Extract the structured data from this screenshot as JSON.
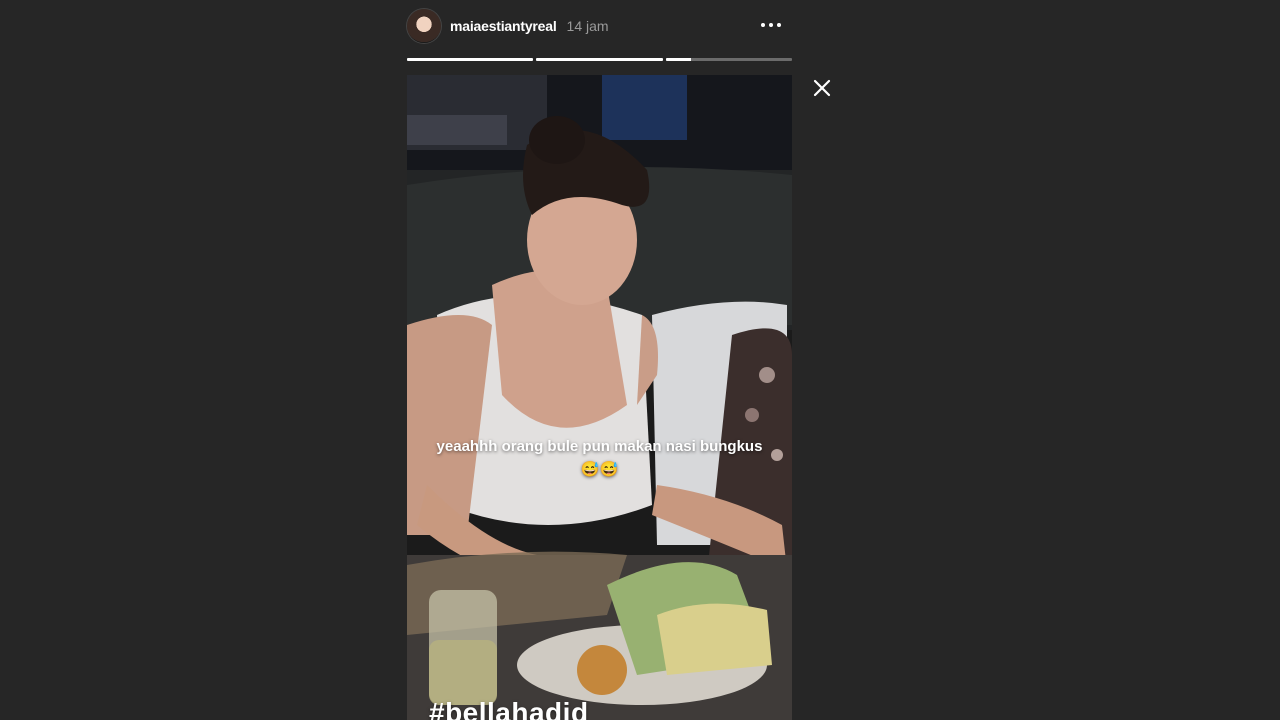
{
  "story": {
    "username": "maiaestiantyreal",
    "timestamp": "14 jam",
    "caption": "yeaahhh orang bule pun makan nasi bungkus 😅😅",
    "hashtag": "#bellahadid",
    "progress": [
      1.0,
      1.0,
      0.2
    ]
  },
  "icons": {
    "more": "more-horizontal-icon",
    "close": "close-icon"
  },
  "colors": {
    "background": "#262626",
    "progress_done": "#ffffff",
    "progress_pending": "#6b6b6b"
  }
}
